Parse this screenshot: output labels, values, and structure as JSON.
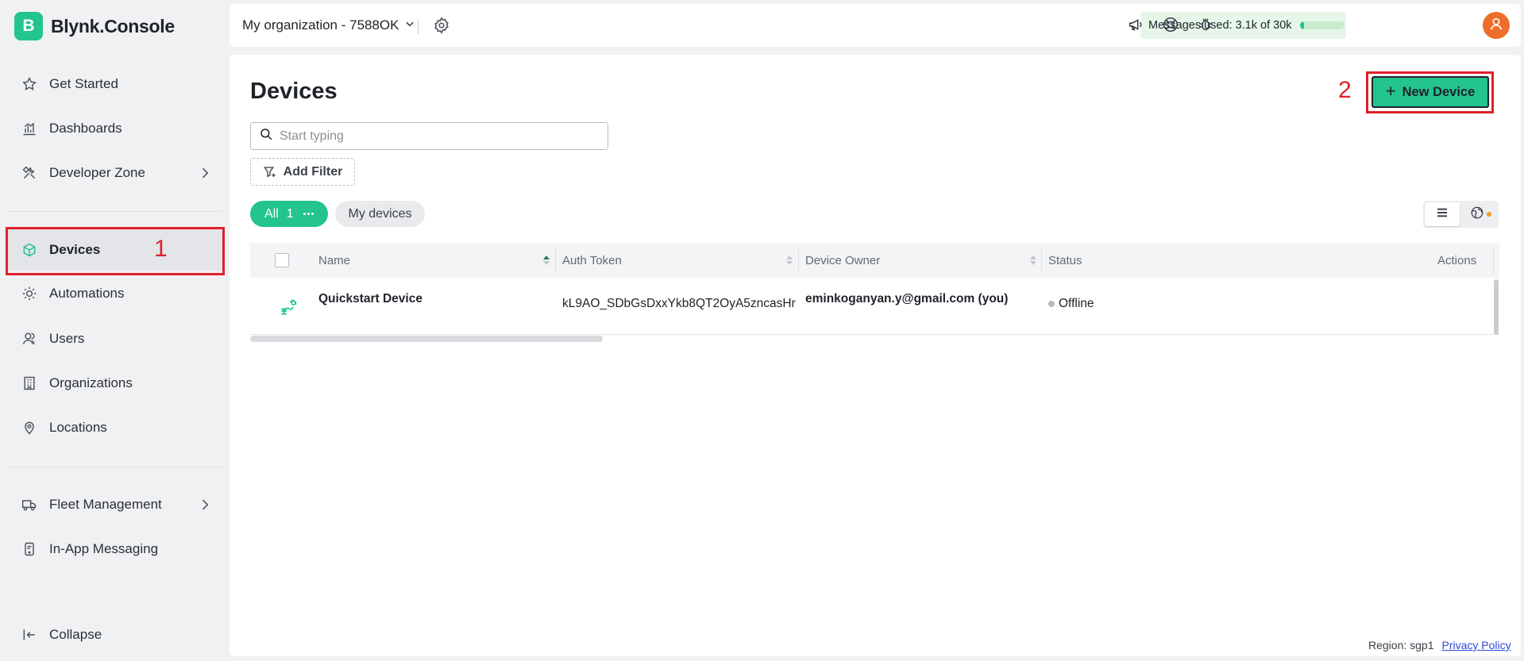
{
  "brand": {
    "logo_letter": "B",
    "name": "Blynk.Console",
    "color": "#23c48e"
  },
  "sidebar": {
    "items": [
      {
        "label": "Get Started",
        "icon": "star-icon"
      },
      {
        "label": "Dashboards",
        "icon": "bar-chart-icon"
      },
      {
        "label": "Developer Zone",
        "icon": "tools-icon",
        "has_submenu": true
      },
      {
        "label": "Devices",
        "icon": "cube-icon",
        "active": true
      },
      {
        "label": "Automations",
        "icon": "automation-icon"
      },
      {
        "label": "Users",
        "icon": "users-icon"
      },
      {
        "label": "Organizations",
        "icon": "building-icon"
      },
      {
        "label": "Locations",
        "icon": "location-pin-icon"
      },
      {
        "label": "Fleet Management",
        "icon": "truck-icon",
        "has_submenu": true
      },
      {
        "label": "In-App Messaging",
        "icon": "messaging-icon"
      },
      {
        "label": "Collapse",
        "icon": "collapse-icon"
      }
    ]
  },
  "annotations": {
    "first": "1",
    "second": "2",
    "color": "#e0202b"
  },
  "topbar": {
    "org_name": "My organization - 7588OK",
    "messages_label": "Messages used:",
    "messages_value": "3.1k of 30k",
    "messages_fraction": 0.103,
    "icons": [
      "megaphone-icon",
      "help-lifebuoy-icon",
      "bug-icon",
      "user-avatar-icon"
    ]
  },
  "main": {
    "title": "Devices",
    "new_device_label": "New Device",
    "search_placeholder": "Start typing",
    "add_filter_label": "Add Filter",
    "filters": {
      "all_label": "All",
      "all_count": "1",
      "my_devices_label": "My devices"
    },
    "table": {
      "columns": [
        "Name",
        "Auth Token",
        "Device Owner",
        "Status",
        "Actions"
      ],
      "rows": [
        {
          "name": "Quickstart Device",
          "auth_token": "kL9AO_SDbGsDxxYkb8QT2OyA5zncasHr",
          "owner": "eminkoganyan.y@gmail.com (you)",
          "status": "Offline"
        }
      ]
    }
  },
  "footer": {
    "region": "Region: sgp1",
    "privacy": "Privacy Policy"
  }
}
